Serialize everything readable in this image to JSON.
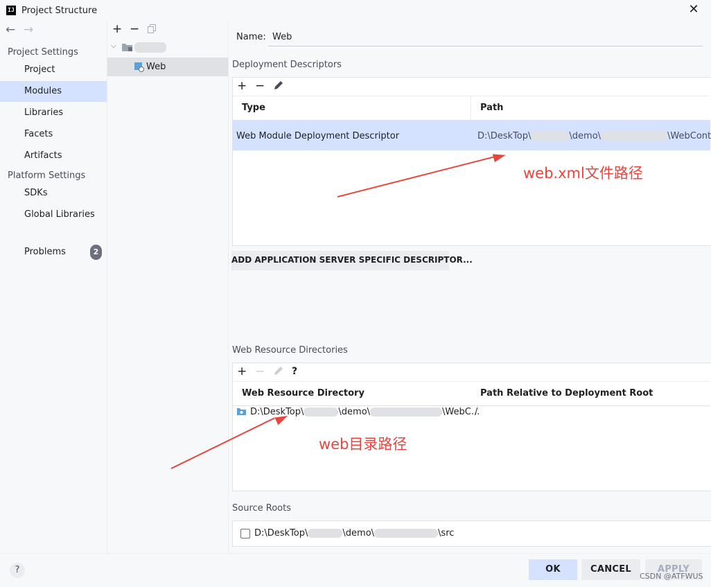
{
  "window": {
    "app_icon_text": "IJ",
    "title": "Project Structure",
    "close_icon": "close-icon"
  },
  "nav": {
    "back_icon": "arrow-left-icon",
    "forward_icon": "arrow-right-icon",
    "section_project": "Project Settings",
    "section_platform": "Platform Settings",
    "items": [
      {
        "label": "Project"
      },
      {
        "label": "Modules"
      },
      {
        "label": "Libraries"
      },
      {
        "label": "Facets"
      },
      {
        "label": "Artifacts"
      },
      {
        "label": "SDKs"
      },
      {
        "label": "Global Libraries"
      },
      {
        "label": "Problems"
      }
    ],
    "selected": "Modules",
    "problems_count": "2"
  },
  "tree": {
    "toolbar": {
      "add": "+",
      "remove": "−",
      "copy_icon": "copy-icon"
    },
    "root_label": "",
    "child_label": "Web"
  },
  "facet": {
    "name_label": "Name:",
    "name_value": "Web"
  },
  "deployment": {
    "title": "Deployment Descriptors",
    "toolbar": {
      "add": "+",
      "remove": "−",
      "edit_icon": "pencil-icon"
    },
    "columns": [
      "Type",
      "Path"
    ],
    "rows": [
      {
        "type": "Web Module Deployment Descriptor",
        "path_start": "D:\\DeskTop\\",
        "path_mid": "\\demo\\",
        "path_end": "\\WebContent"
      }
    ],
    "add_server_descriptor": "ADD APPLICATION SERVER SPECIFIC DESCRIPTOR..."
  },
  "resources": {
    "title": "Web Resource Directories",
    "toolbar": {
      "add": "+",
      "remove": "−",
      "edit_icon": "pencil-icon",
      "help": "?"
    },
    "columns": [
      "Web Resource Directory",
      "Path Relative to Deployment Root"
    ],
    "rows": [
      {
        "dir_start": "D:\\DeskTop\\",
        "dir_mid": "\\demo\\",
        "dir_end": "\\WebC...",
        "relative": "/"
      }
    ]
  },
  "source_roots": {
    "title": "Source Roots",
    "path_start": "D:\\DeskTop\\",
    "path_mid": "\\demo\\",
    "path_end": "\\src",
    "checked": false
  },
  "annotations": {
    "descriptor": "web.xml文件路径",
    "directory": "web目录路径",
    "color": "#e8453c"
  },
  "footer": {
    "help": "?",
    "ok": "OK",
    "cancel": "CANCEL",
    "apply": "APPLY",
    "watermark": "CSDN @ATFWUS"
  },
  "colors": {
    "selection": "#d4e2ff",
    "background": "#f7f8fa",
    "accent_folder": "#5fa0d3"
  }
}
